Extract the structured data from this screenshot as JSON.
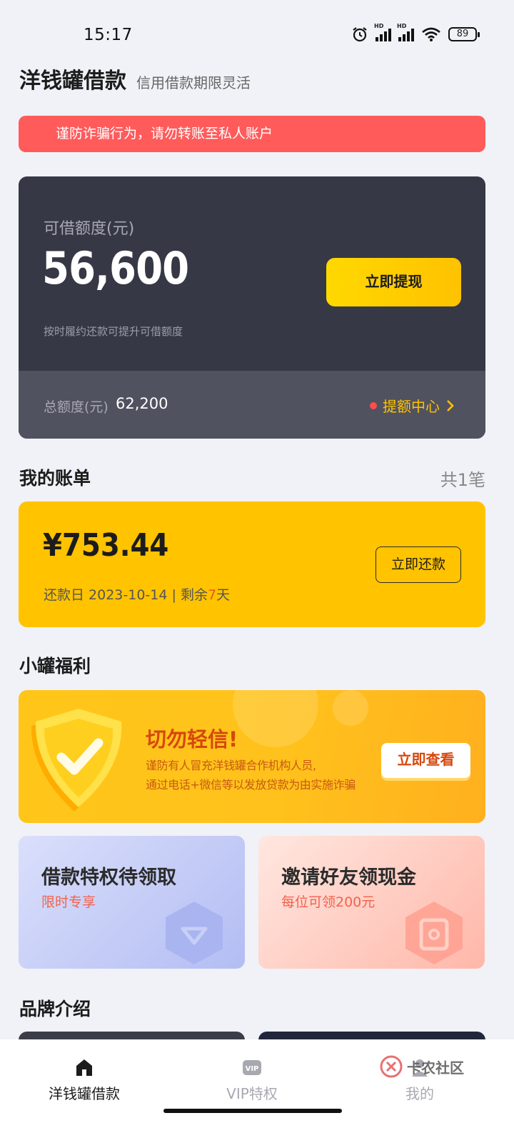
{
  "status_bar": {
    "time": "15:17",
    "battery": "89",
    "signal_tag": "HD"
  },
  "header": {
    "title": "洋钱罐借款",
    "subtitle": "信用借款期限灵活"
  },
  "fraud_banner": {
    "text": "谨防诈骗行为，请勿转账至私人账户"
  },
  "credit": {
    "label": "可借额度(元)",
    "amount": "56,600",
    "hint": "按时履约还款可提升可借额度",
    "withdraw_label": "立即提现",
    "total_label": "总额度(元)",
    "total_value": "62,200",
    "quota_center_label": "提额中心"
  },
  "bills": {
    "title": "我的账单",
    "count": "共1笔",
    "amount": "¥753.44",
    "due_prefix": "还款日 2023-10-14 | 剩余",
    "days_left": "7",
    "due_suffix": "天",
    "repay_label": "立即还款"
  },
  "benefits": {
    "title": "小罐福利",
    "warning": {
      "title": "切勿轻信!",
      "line1": "谨防有人冒充洋钱罐合作机构人员,",
      "line2": "通过电话+微信等以发放贷款为由实施诈骗",
      "button": "立即查看"
    },
    "promos": [
      {
        "title": "借款特权待领取",
        "subtitle": "限时专享"
      },
      {
        "title": "邀请好友领现金",
        "subtitle": "每位可领200元"
      }
    ]
  },
  "brand": {
    "title": "品牌介绍"
  },
  "tabbar": {
    "tabs": [
      {
        "label": "洋钱罐借款"
      },
      {
        "label": "VIP特权",
        "badge": "VIP"
      },
      {
        "label": "我的"
      }
    ],
    "watermark": "卡农社区"
  },
  "colors": {
    "accent_yellow": "#ffc300",
    "banner_red": "#ff5b5b",
    "card_dark": "#363845"
  }
}
